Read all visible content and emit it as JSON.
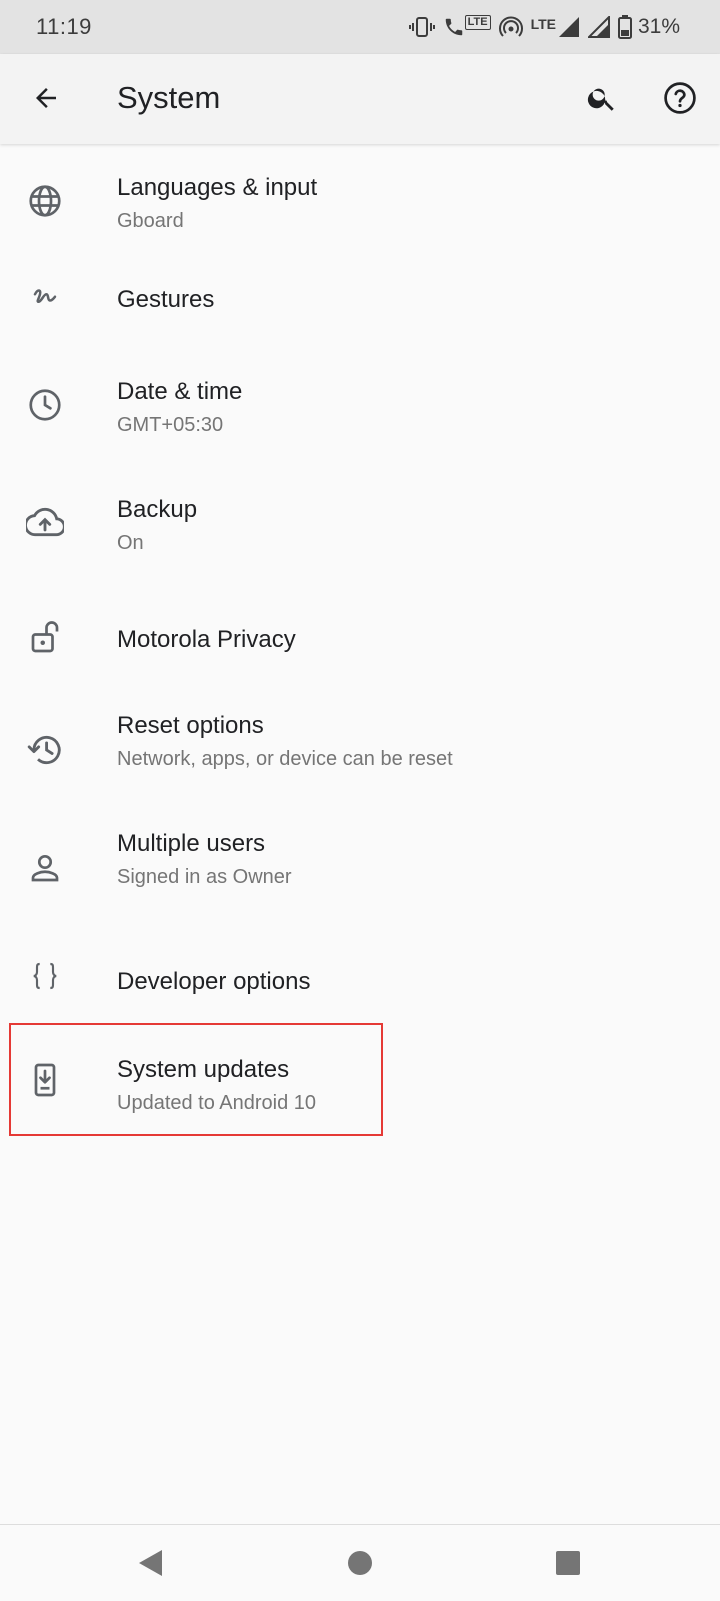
{
  "status_bar": {
    "time": "11:19",
    "lte_badge": "LTE",
    "network_label": "LTE",
    "battery_percent": "31%",
    "icons": [
      "vibrate-icon",
      "volte-call-icon",
      "hotspot-icon",
      "signal-icon",
      "signal-icon",
      "battery-icon"
    ]
  },
  "app_bar": {
    "title": "System",
    "icons": [
      "back-arrow-icon",
      "search-icon",
      "help-icon"
    ]
  },
  "settings": [
    {
      "icon": "globe-icon",
      "title": "Languages & input",
      "subtitle": "Gboard"
    },
    {
      "icon": "gesture-icon",
      "title": "Gestures",
      "subtitle": ""
    },
    {
      "icon": "clock-icon",
      "title": "Date & time",
      "subtitle": "GMT+05:30"
    },
    {
      "icon": "cloud-upload-icon",
      "title": "Backup",
      "subtitle": "On"
    },
    {
      "icon": "lock-open-icon",
      "title": "Motorola Privacy",
      "subtitle": ""
    },
    {
      "icon": "history-icon",
      "title": "Reset options",
      "subtitle": "Network, apps, or device can be reset"
    },
    {
      "icon": "person-icon",
      "title": "Multiple users",
      "subtitle": "Signed in as Owner"
    },
    {
      "icon": "code-braces-icon",
      "title": "Developer options",
      "subtitle": ""
    },
    {
      "icon": "system-update-icon",
      "title": "System updates",
      "subtitle": "Updated to Android 10"
    }
  ],
  "highlight": {
    "target": "System updates",
    "color": "#e53935"
  },
  "nav_bar": {
    "icons": [
      "nav-back-icon",
      "nav-home-icon",
      "nav-recents-icon"
    ]
  }
}
